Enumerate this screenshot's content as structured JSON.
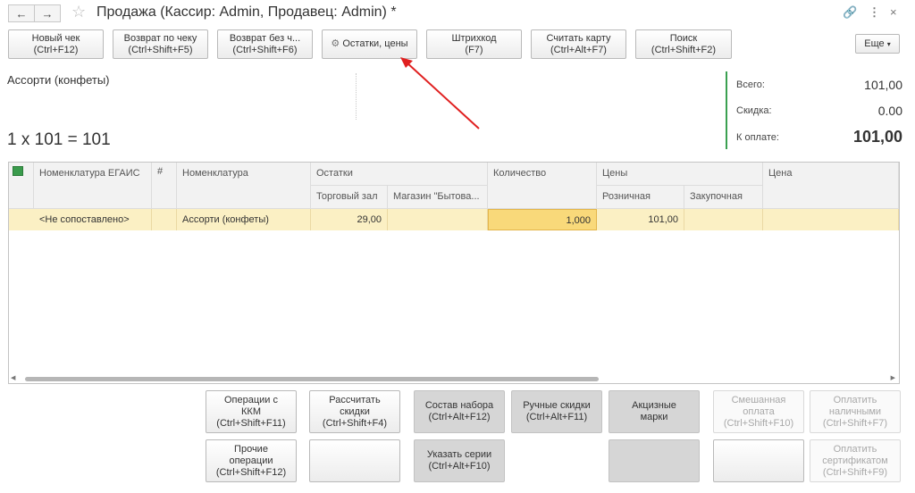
{
  "window": {
    "title": "Продажа (Кассир: Admin, Продавец: Admin) *"
  },
  "toolbar": {
    "buttons": [
      {
        "l1": "Новый чек",
        "l2": "(Ctrl+F12)"
      },
      {
        "l1": "Возврат по чеку",
        "l2": "(Ctrl+Shift+F5)"
      },
      {
        "l1": "Возврат без ч...",
        "l2": "(Ctrl+Shift+F6)"
      },
      {
        "l1": "Остатки, цены",
        "l2": ""
      },
      {
        "l1": "Штрихкод",
        "l2": "(F7)"
      },
      {
        "l1": "Считать карту",
        "l2": "(Ctrl+Alt+F7)"
      },
      {
        "l1": "Поиск",
        "l2": "(Ctrl+Shift+F2)"
      }
    ],
    "more": "Еще"
  },
  "info": {
    "product": "Ассорти (конфеты)",
    "calc": "1 x 101 = 101"
  },
  "totals": {
    "total_label": "Всего:",
    "total_value": "101,00",
    "discount_label": "Скидка:",
    "discount_value": "0.00",
    "pay_label": "К оплате:",
    "pay_value": "101,00"
  },
  "table": {
    "h_egais": "Номенклатура ЕГАИС",
    "h_hash": "#",
    "h_nom": "Номенклатура",
    "h_stock": "Остатки",
    "h_stock_a": "Торговый зал",
    "h_stock_b": "Магазин \"Бытова...",
    "h_qty": "Количество",
    "h_prices": "Цены",
    "h_retail": "Розничная",
    "h_purchase": "Закупочная",
    "h_price": "Цена",
    "rows": [
      {
        "egais": "<Не сопоставлено>",
        "nom": "Ассорти (конфеты)",
        "stock_a": "29,00",
        "stock_b": "",
        "qty": "1,000",
        "retail": "101,00",
        "purchase": "",
        "price": ""
      }
    ]
  },
  "actions": {
    "r1": [
      {
        "l1": "Операции с",
        "l2": "ККМ",
        "l3": "(Ctrl+Shift+F11)"
      },
      {
        "l1": "Рассчитать",
        "l2": "скидки",
        "l3": "(Ctrl+Shift+F4)"
      },
      {
        "l1": "Состав набора",
        "l2": "(Ctrl+Alt+F12)",
        "l3": ""
      },
      {
        "l1": "Ручные скидки",
        "l2": "(Ctrl+Alt+F11)",
        "l3": ""
      },
      {
        "l1": "Акцизные",
        "l2": "марки",
        "l3": ""
      },
      {
        "l1": "Смешанная",
        "l2": "оплата",
        "l3": "(Ctrl+Shift+F10)"
      },
      {
        "l1": "Оплатить",
        "l2": "наличными",
        "l3": "(Ctrl+Shift+F7)"
      }
    ],
    "r2": [
      {
        "l1": "Прочие",
        "l2": "операции",
        "l3": "(Ctrl+Shift+F12)"
      },
      {
        "l1": "",
        "l2": "",
        "l3": ""
      },
      {
        "l1": "Указать серии",
        "l2": "(Ctrl+Alt+F10)",
        "l3": ""
      },
      {
        "l1": "",
        "l2": "",
        "l3": ""
      },
      {
        "l1": "",
        "l2": "",
        "l3": ""
      },
      {
        "l1": "",
        "l2": "",
        "l3": ""
      },
      {
        "l1": "Оплатить",
        "l2": "сертификатом",
        "l3": "(Ctrl+Shift+F9)"
      }
    ]
  },
  "colors": {
    "accent_green": "#3aa050",
    "row_highlight": "#fbf0c4",
    "qty_cell": "#f9d97a",
    "arrow": "#e02020"
  }
}
